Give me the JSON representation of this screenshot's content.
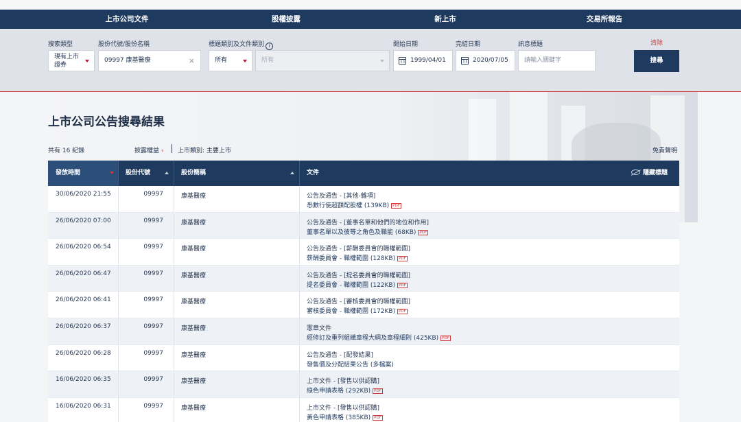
{
  "nav": [
    "上市公司文件",
    "股權披露",
    "新上市",
    "交易所報告"
  ],
  "search": {
    "labels": {
      "search_type": "搜索類型",
      "stock": "股份代號/股份名稱",
      "category": "標題類別及文件類別",
      "start_date": "開始日期",
      "end_date": "完結日期",
      "headline": "訊息標題"
    },
    "search_type_value": "現有上市證券",
    "stock_value": "09997 康基醫療",
    "category_value": "所有",
    "doc_category_value": "所有",
    "start_date": "1999/04/01",
    "end_date": "2020/07/05",
    "headline_placeholder": "請輸入關鍵字",
    "clear": "清除",
    "search_button": "搜尋"
  },
  "page_title": "上市公司公告搜尋結果",
  "meta": {
    "count": "共有 16 紀錄",
    "disclosure": "披露權益",
    "category": "上市類別: 主要上市",
    "disclaimer": "免責聲明"
  },
  "table": {
    "headers": {
      "time": "發放時間",
      "code": "股份代號",
      "name": "股份簡稱",
      "doc": "文件",
      "hide": "隱藏標題"
    },
    "rows": [
      {
        "time": "30/06/2020 21:55",
        "code": "09997",
        "name": "康基醫療",
        "doc_type": "公告及通告 - [其他-雜項]",
        "doc_title": "悉數行使超額配股權 (139KB)",
        "pdf": "PDF"
      },
      {
        "time": "26/06/2020 07:00",
        "code": "09997",
        "name": "康基醫療",
        "doc_type": "公告及通告 - [董事名單和他們的地位和作用]",
        "doc_title": "董事名單以及彼等之角色及職能 (68KB)",
        "pdf": "PDF"
      },
      {
        "time": "26/06/2020 06:54",
        "code": "09997",
        "name": "康基醫療",
        "doc_type": "公告及通告 - [薪酬委員會的職權範圍]",
        "doc_title": "薪酬委員會 - 職權範圍 (128KB)",
        "pdf": "PDF"
      },
      {
        "time": "26/06/2020 06:47",
        "code": "09997",
        "name": "康基醫療",
        "doc_type": "公告及通告 - [提名委員會的職權範圍]",
        "doc_title": "提名委員會 - 職權範圍 (122KB)",
        "pdf": "PDF"
      },
      {
        "time": "26/06/2020 06:41",
        "code": "09997",
        "name": "康基醫療",
        "doc_type": "公告及通告 - [審核委員會的職權範圍]",
        "doc_title": "審核委員會 - 職權範圍 (172KB)",
        "pdf": "PDF"
      },
      {
        "time": "26/06/2020 06:37",
        "code": "09997",
        "name": "康基醫療",
        "doc_type": "憲章文件",
        "doc_title": "經修訂及重列組織章程大綱及章程細則 (425KB)",
        "pdf": "PDF"
      },
      {
        "time": "26/06/2020 06:28",
        "code": "09997",
        "name": "康基醫療",
        "doc_type": "公告及通告 - [配發結果]",
        "doc_title": "發售價及分配結果公告 (多檔案)",
        "pdf": ""
      },
      {
        "time": "16/06/2020 06:35",
        "code": "09997",
        "name": "康基醫療",
        "doc_type": "上市文件 - [發售以供認購]",
        "doc_title": "綠色申請表格 (292KB)",
        "pdf": "PDF"
      },
      {
        "time": "16/06/2020 06:31",
        "code": "09997",
        "name": "康基醫療",
        "doc_type": "上市文件 - [發售以供認購]",
        "doc_title": "黃色申請表格 (385KB)",
        "pdf": "PDF"
      }
    ]
  }
}
